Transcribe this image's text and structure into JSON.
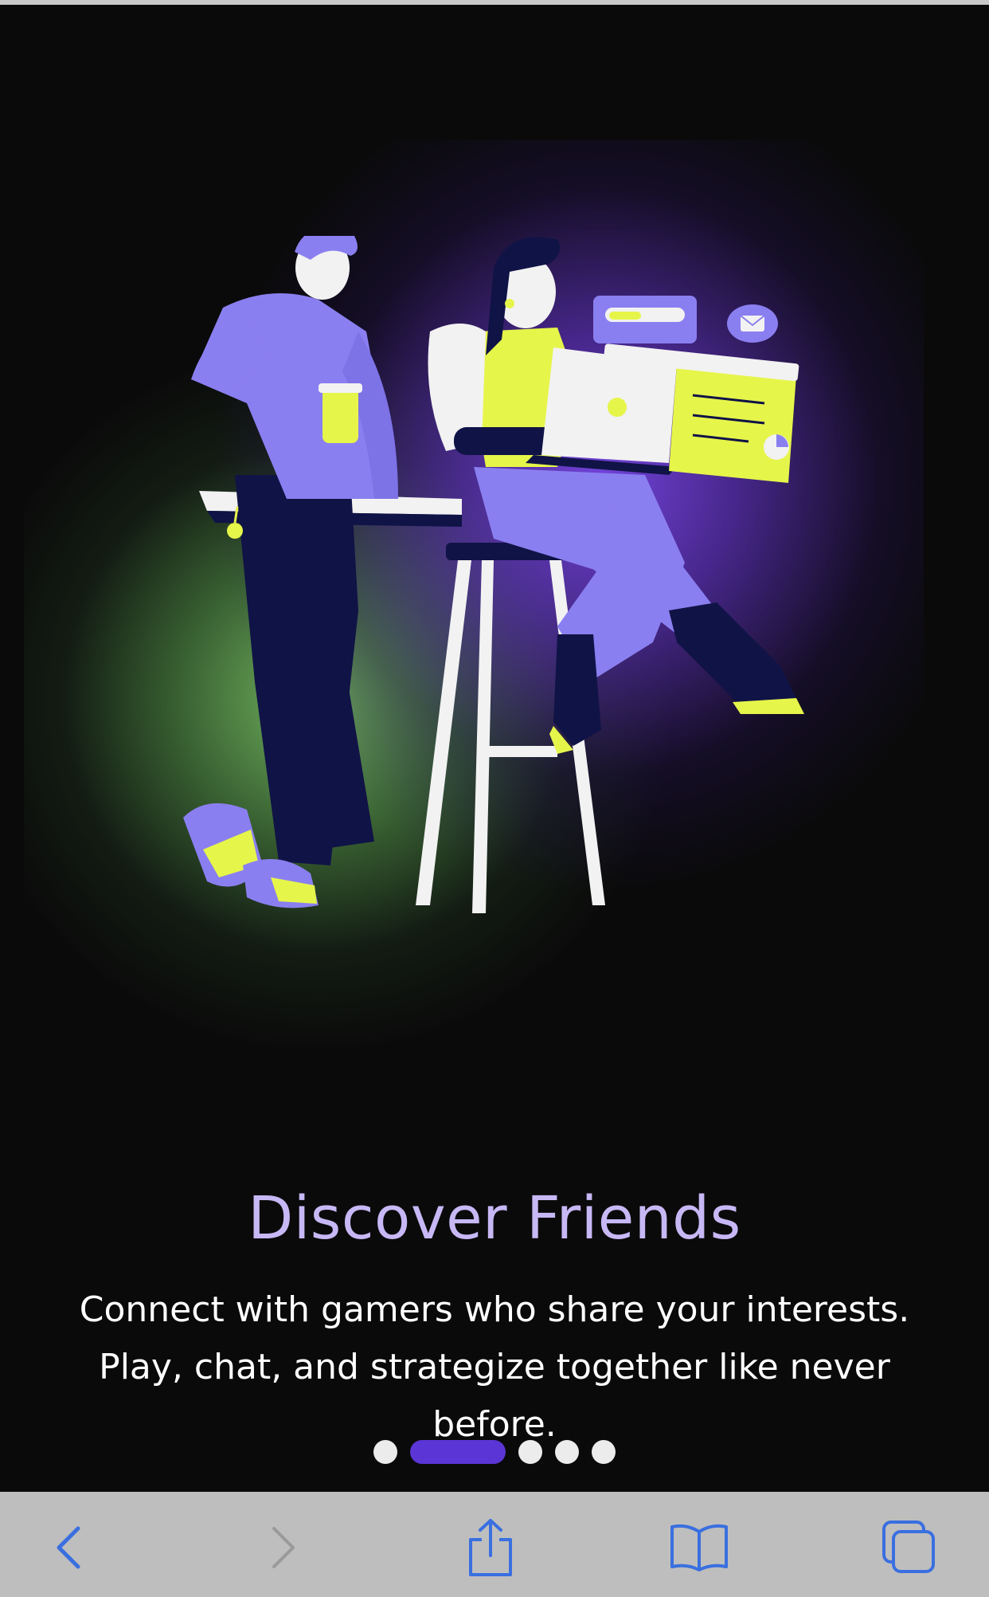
{
  "onboarding": {
    "title": "Discover Friends",
    "description": "Connect with gamers who share your interests. Play, chat, and strategize together like never before.",
    "pagination": {
      "total": 5,
      "current": 2
    }
  },
  "toolbar": {
    "buttons": [
      "back-icon",
      "forward-icon",
      "share-icon",
      "bookmarks-icon",
      "tabs-icon"
    ],
    "forward_enabled": false
  },
  "colors": {
    "accent": "#5b35d5",
    "title": "#c7b8f5",
    "illustration_purple": "#8a7ff0",
    "illustration_lime": "#e6f54a",
    "illustration_navy": "#101346",
    "toolbar_icon": "#3a6fe0"
  }
}
